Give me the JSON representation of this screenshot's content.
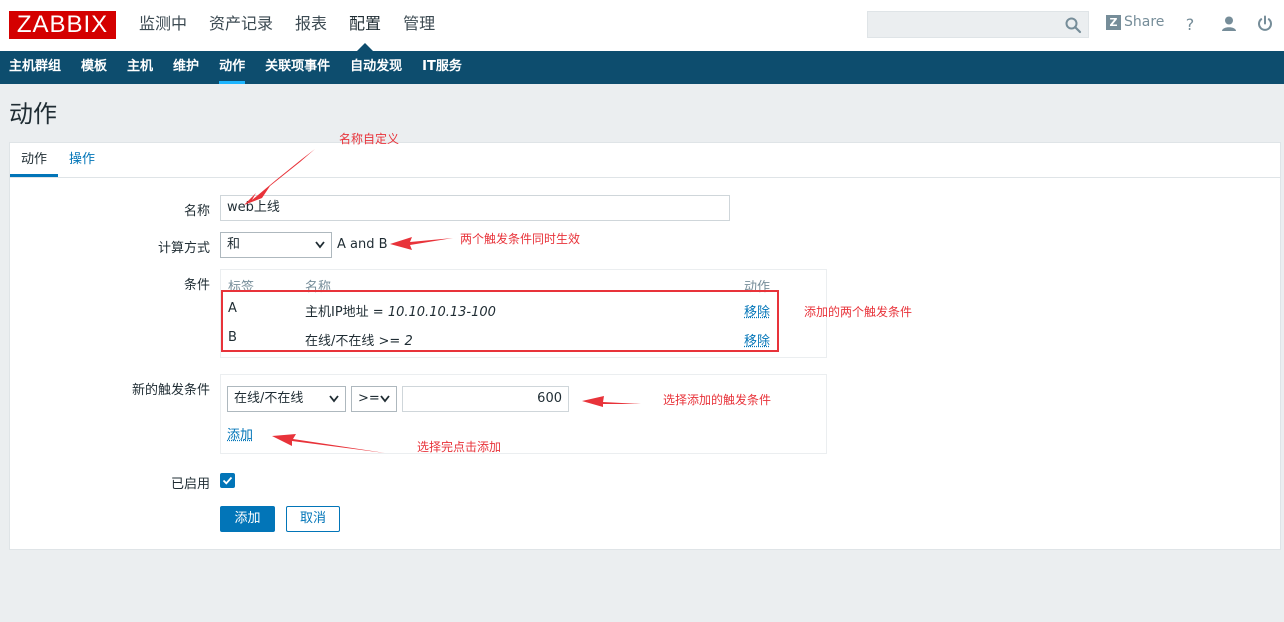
{
  "header": {
    "logo": "ZABBIX",
    "nav": [
      "监测中",
      "资产记录",
      "报表",
      "配置",
      "管理"
    ],
    "active_nav": "配置",
    "search_placeholder": "",
    "share_icon_letter": "Z",
    "share_label": "Share",
    "icons": [
      "search-icon",
      "help-icon",
      "user-icon",
      "power-icon"
    ]
  },
  "subnav": {
    "items": [
      "主机群组",
      "模板",
      "主机",
      "维护",
      "动作",
      "关联项事件",
      "自动发现",
      "IT服务"
    ],
    "active": "动作"
  },
  "page": {
    "title": "动作"
  },
  "tabs": [
    "动作",
    "操作"
  ],
  "form": {
    "name_label": "名称",
    "name_value": "web上线",
    "calc_label": "计算方式",
    "calc_value": "和",
    "calc_formula": "A and B",
    "conditions_label": "条件",
    "conditions_headers": {
      "label": "标签",
      "name": "名称",
      "action": "动作"
    },
    "conditions": [
      {
        "label": "A",
        "name_prefix": "主机IP地址 = ",
        "name_value": "10.10.10.13-100",
        "action": "移除"
      },
      {
        "label": "B",
        "name_prefix": "在线/不在线 >= ",
        "name_value": "2",
        "action": "移除"
      }
    ],
    "new_condition_label": "新的触发条件",
    "new_condition_type": "在线/不在线",
    "new_condition_operator": ">=",
    "new_condition_value": "600",
    "new_condition_add": "添加",
    "enabled_label": "已启用",
    "enabled": true,
    "submit_label": "添加",
    "cancel_label": "取消"
  },
  "annotations": {
    "name_note": "名称自定义",
    "calc_note": "两个触发条件同时生效",
    "conditions_note": "添加的两个触发条件",
    "select_note": "选择添加的触发条件",
    "add_note": "选择完点击添加",
    "color": "#e8333a"
  },
  "colors": {
    "brand": "#d40000",
    "subnav_bg": "#0d4d6e",
    "link": "#0275b8",
    "page_bg": "#ebeef0"
  }
}
